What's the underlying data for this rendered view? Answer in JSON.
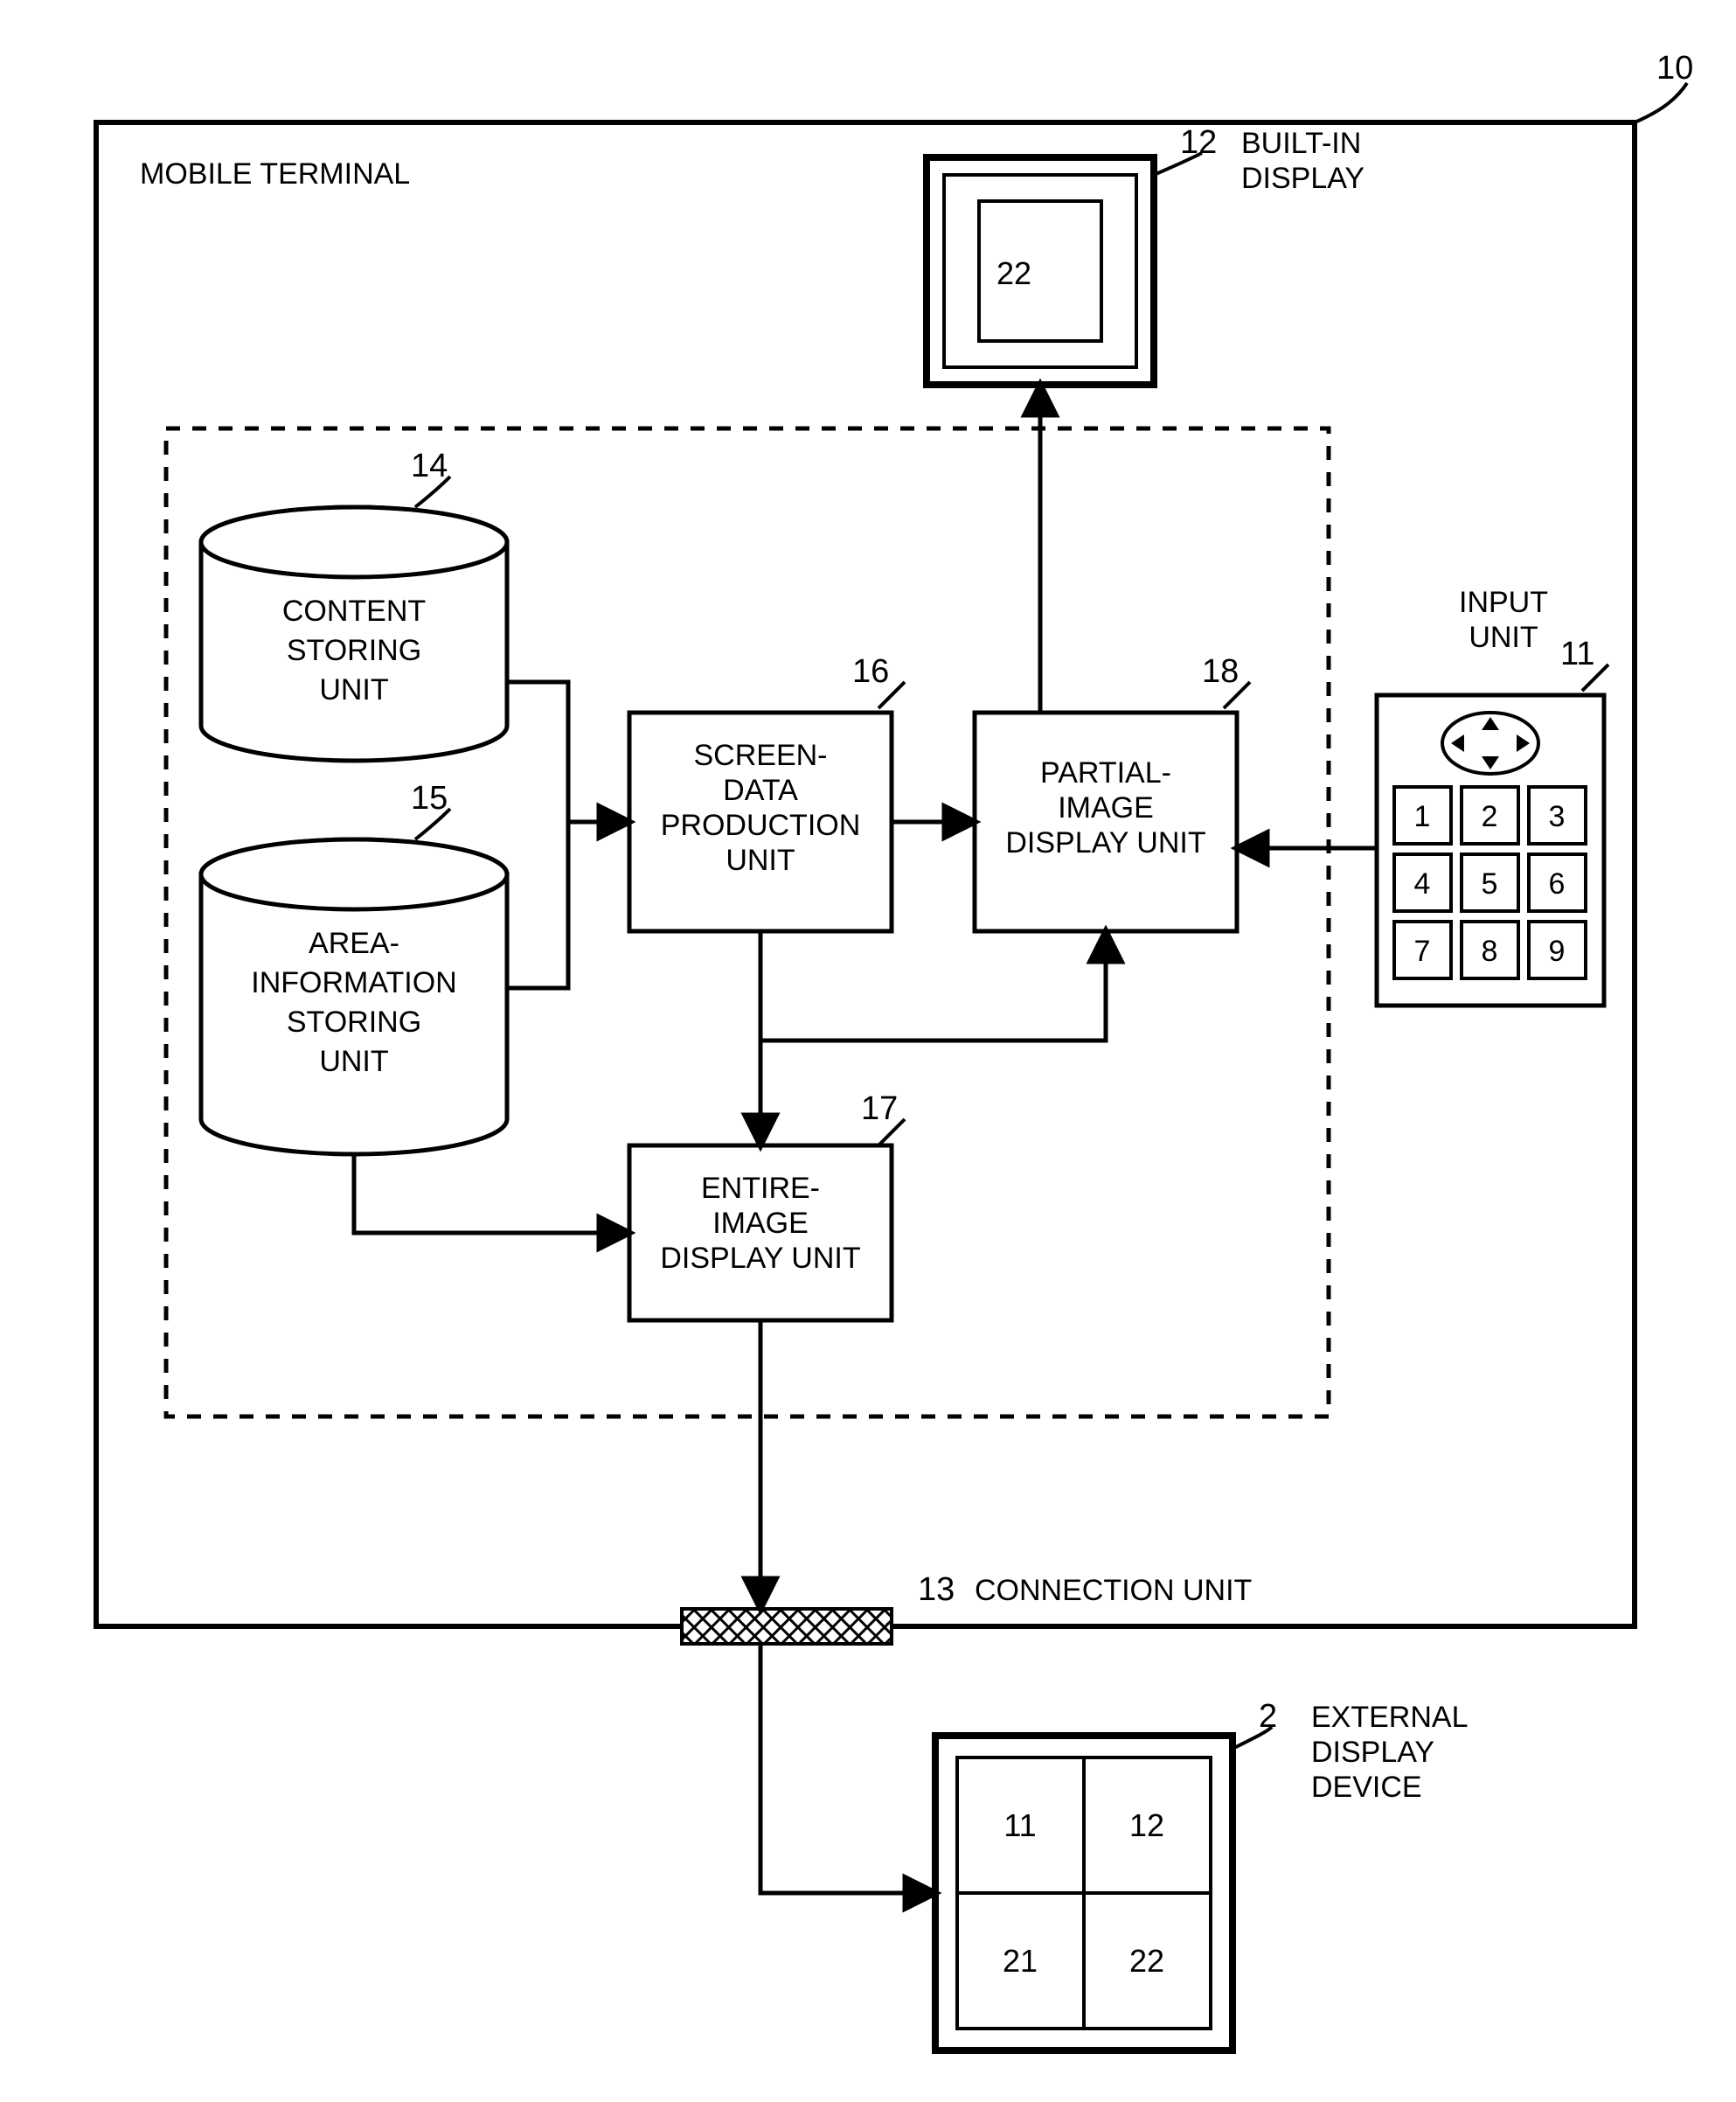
{
  "refs": {
    "terminal": "10",
    "input_unit": "11",
    "builtin_display": "12",
    "connection_unit": "13",
    "content_store": "14",
    "area_store": "15",
    "screen_data_unit": "16",
    "entire_image_unit": "17",
    "partial_image_unit": "18",
    "external_display": "2",
    "builtin_screen_value": "22"
  },
  "labels": {
    "mobile_terminal": "MOBILE TERMINAL",
    "builtin_display": "BUILT-IN\nDISPLAY",
    "input_unit": "INPUT\nUNIT",
    "content_storing": "CONTENT\nSTORING\nUNIT",
    "area_info_storing": "AREA-\nINFORMATION\nSTORING\nUNIT",
    "screen_data_prod": "SCREEN-\nDATA\nPRODUCTION\nUNIT",
    "entire_image_disp": "ENTIRE-\nIMAGE\nDISPLAY UNIT",
    "partial_image_disp": "PARTIAL-\nIMAGE\nDISPLAY UNIT",
    "connection_unit": "CONNECTION UNIT",
    "external_display": "EXTERNAL\nDISPLAY\nDEVICE"
  },
  "keypad": [
    "1",
    "2",
    "3",
    "4",
    "5",
    "6",
    "7",
    "8",
    "9"
  ],
  "external_grid": [
    "11",
    "12",
    "21",
    "22"
  ]
}
